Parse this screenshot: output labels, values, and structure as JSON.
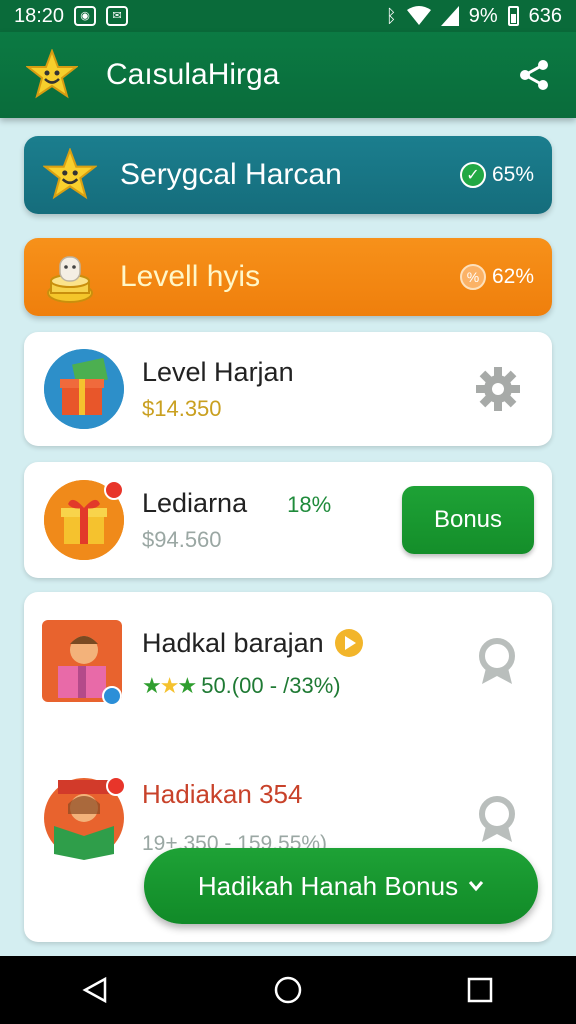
{
  "status_bar": {
    "time": "18:20",
    "battery": "9%",
    "right_time": "636"
  },
  "app_bar": {
    "title": "CaısulaHirga",
    "logo_icon": "star-face-icon",
    "share_icon": "share-icon"
  },
  "banners": [
    {
      "title": "Serygcal Harcan",
      "badge": "65%",
      "badge_icon": "check-icon",
      "color": "#1b7e8e"
    },
    {
      "title": "Levell hyis",
      "badge": "62%",
      "badge_icon": "percent-icon",
      "color": "#f7911a"
    }
  ],
  "cards": [
    {
      "title": "Level Harjan",
      "sub": "$14.350",
      "action_icon": "gear-icon"
    },
    {
      "title": "Lediarna",
      "percent": "18%",
      "sub": "$94.560",
      "button": "Bonus"
    }
  ],
  "list": {
    "item1": {
      "title": "Hadkal barajan",
      "rating": "50.(00 - /33%)"
    },
    "item2": {
      "title": "Hadiakan 354",
      "sub": "19+.350 - 159.55%)"
    }
  },
  "cta": {
    "label": "Hadikah Hanah Bonus",
    "icon": "chevron-down-icon"
  },
  "colors": {
    "primary": "#0b7a43",
    "accent": "#1ea236",
    "teal": "#1b7e8e",
    "orange": "#f7911a"
  }
}
